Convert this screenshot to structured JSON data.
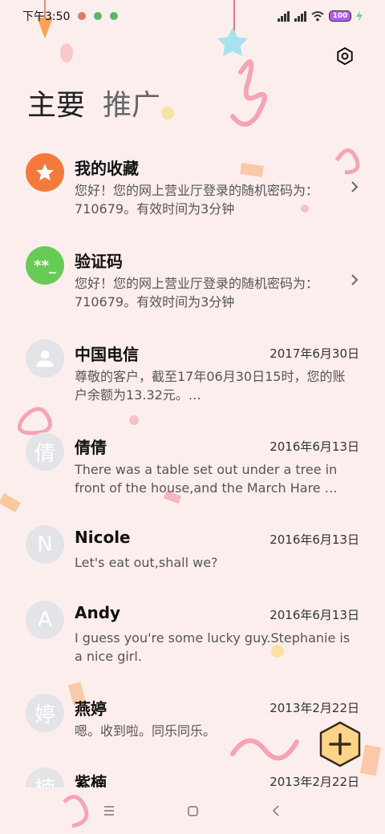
{
  "status_bar": {
    "time": "下午3:50",
    "battery": "100"
  },
  "tabs": [
    {
      "label": "主要"
    },
    {
      "label": "推广"
    }
  ],
  "messages": [
    {
      "avatar_text": "★",
      "avatar_color": "#f47a3c",
      "name": "我的收藏",
      "date": "",
      "text": "您好！您的网上营业厅登录的随机密码为：710679。有效时间为3分钟",
      "chevron": true
    },
    {
      "avatar_text": "**_",
      "avatar_color": "#66cc55",
      "name": "验证码",
      "date": "",
      "text": "您好！您的网上营业厅登录的随机密码为：710679。有效时间为3分钟",
      "chevron": true
    },
    {
      "avatar_text": "",
      "avatar_color": "#e2e4e7",
      "name": "中国电信",
      "date": "2017年6月30日",
      "text": "尊敬的客户，截至17年06月30日15时，您的账户余额为13.32元。…",
      "chevron": false
    },
    {
      "avatar_text": "倩",
      "avatar_color": "#e2e4e7",
      "name": "倩倩",
      "date": "2016年6月13日",
      "text": "There was a table set out under a tree in front of the house,and the March Hare …",
      "chevron": false
    },
    {
      "avatar_text": "N",
      "avatar_color": "#e2e4e7",
      "name": "Nicole",
      "date": "2016年6月13日",
      "text": "Let's eat out,shall we?",
      "chevron": false
    },
    {
      "avatar_text": "A",
      "avatar_color": "#e2e4e7",
      "name": "Andy",
      "date": "2016年6月13日",
      "text": "I guess you're some lucky guy.Stephanie is a nice girl.",
      "chevron": false
    },
    {
      "avatar_text": "婷",
      "avatar_color": "#e2e4e7",
      "name": "燕婷",
      "date": "2013年2月22日",
      "text": "嗯。收到啦。同乐同乐。",
      "chevron": false
    },
    {
      "avatar_text": "楠",
      "avatar_color": "#e2e4e7",
      "name": "紫楠",
      "date": "2013年2月22日",
      "text": "",
      "chevron": false
    }
  ],
  "icons": {
    "settings": "settings-icon",
    "compose": "compose-plus-icon",
    "nav": [
      "menu-icon",
      "home-icon",
      "back-icon"
    ]
  }
}
